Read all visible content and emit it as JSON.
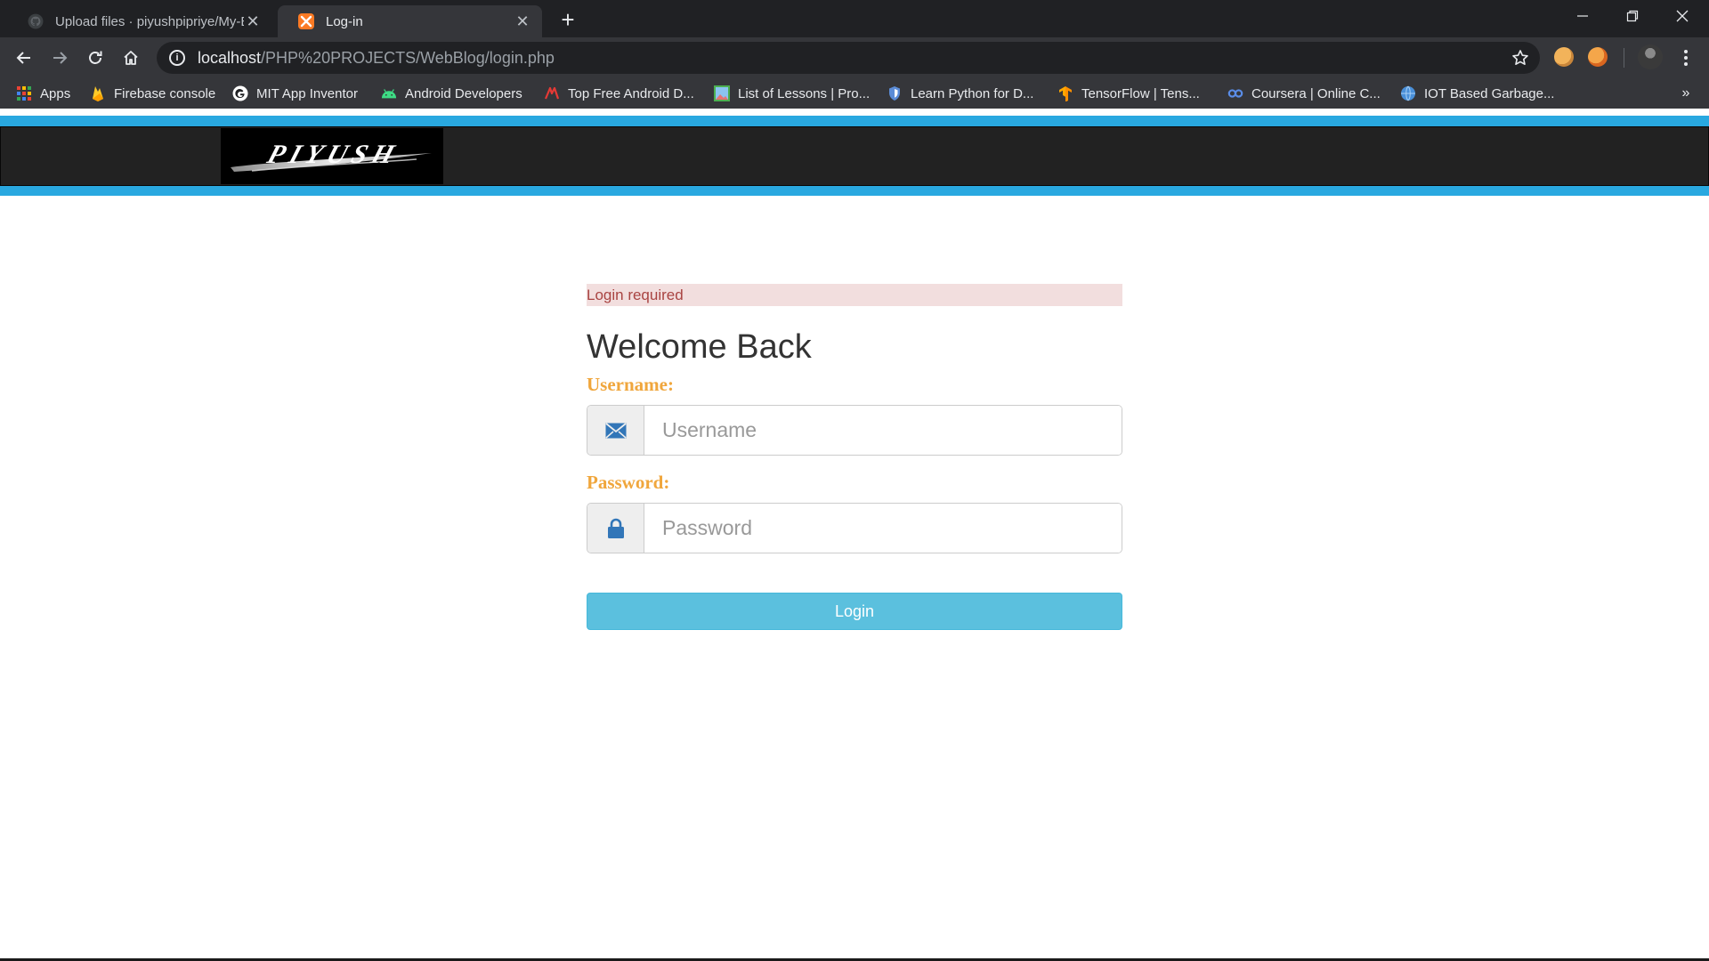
{
  "browser": {
    "tabs": [
      {
        "title": "Upload files · piyushpipriye/My-Blog",
        "active": false
      },
      {
        "title": "Log-in",
        "active": true
      }
    ],
    "new_tab_symbol": "+",
    "close_symbol": "✕",
    "address": {
      "host": "localhost",
      "path": "/PHP%20PROJECTS/WebBlog/login.php"
    },
    "bookmarks": [
      {
        "label": "Apps",
        "icon": "apps-grid-icon"
      },
      {
        "label": "Firebase console",
        "icon": "firebase-icon"
      },
      {
        "label": "MIT App Inventor",
        "icon": "google-icon"
      },
      {
        "label": "Android Developers",
        "icon": "android-icon"
      },
      {
        "label": "Top Free Android D...",
        "icon": "android-d-icon"
      },
      {
        "label": "List of Lessons | Pro...",
        "icon": "lessons-icon"
      },
      {
        "label": "Learn Python for D...",
        "icon": "shield-icon"
      },
      {
        "label": "TensorFlow  |  Tens...",
        "icon": "tensorflow-icon"
      },
      {
        "label": "Coursera | Online C...",
        "icon": "coursera-icon"
      },
      {
        "label": "IOT Based Garbage...",
        "icon": "globe-icon"
      }
    ],
    "bookmarks_more": "»",
    "colors": {
      "chrome_dark": "#202124",
      "chrome_toolbar": "#35363a"
    }
  },
  "site": {
    "logo_text": "PIYUSH",
    "colors": {
      "stripe": "#29a8e0",
      "header": "#222222",
      "label": "#f0a63c",
      "button": "#5bc0de"
    }
  },
  "login": {
    "alert": "Login required",
    "heading": "Welcome Back",
    "username_label": "Username:",
    "username_placeholder": "Username",
    "username_icon": "envelope-icon",
    "password_label": "Password:",
    "password_placeholder": "Password",
    "password_icon": "lock-icon",
    "button": "Login"
  }
}
